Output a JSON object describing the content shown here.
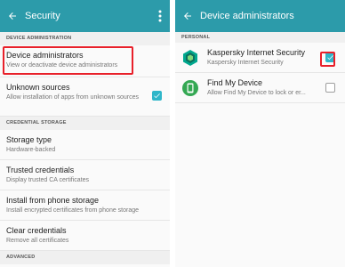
{
  "left": {
    "header": {
      "title": "Security"
    },
    "sections": [
      {
        "heading": "DEVICE ADMINISTRATION"
      },
      {
        "heading": "CREDENTIAL STORAGE"
      },
      {
        "heading": "ADVANCED"
      }
    ],
    "items": {
      "device_admins": {
        "title": "Device administrators",
        "subtitle": "View or deactivate device administrators"
      },
      "unknown_sources": {
        "title": "Unknown sources",
        "subtitle": "Allow installation of apps from unknown sources",
        "checked": true
      },
      "storage_type": {
        "title": "Storage type",
        "subtitle": "Hardware-backed"
      },
      "trusted_credentials": {
        "title": "Trusted credentials",
        "subtitle": "Display trusted CA certificates"
      },
      "install_from_storage": {
        "title": "Install from phone storage",
        "subtitle": "Install encrypted certificates from phone storage"
      },
      "clear_credentials": {
        "title": "Clear credentials",
        "subtitle": "Remove all certificates"
      }
    }
  },
  "right": {
    "header": {
      "title": "Device administrators"
    },
    "section": {
      "heading": "PERSONAL"
    },
    "items": [
      {
        "title": "Kaspersky Internet Security",
        "subtitle": "Kaspersky Internet Security",
        "checked": true,
        "icon": "kaspersky-shield-icon"
      },
      {
        "title": "Find My Device",
        "subtitle": "Allow Find My Device to lock or er...",
        "checked": false,
        "icon": "find-my-device-icon"
      }
    ]
  },
  "colors": {
    "appbar": "#2c9baa",
    "checkbox_accent": "#2fb6c9",
    "highlight": "#e8202a",
    "kaspersky_green": "#00a88e",
    "find_my_device_green": "#34a853"
  }
}
